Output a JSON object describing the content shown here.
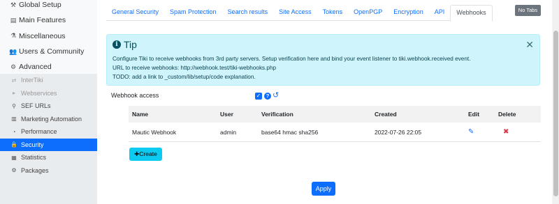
{
  "sidebar": {
    "top_items": [
      {
        "icon": "wrench-icon",
        "glyph": "⚒",
        "label": "Global Setup"
      },
      {
        "icon": "features-icon",
        "glyph": "▤",
        "label": "Main Features"
      },
      {
        "icon": "misc-icon",
        "glyph": "⚗",
        "label": "Miscellaneous"
      },
      {
        "icon": "users-icon",
        "glyph": "👥",
        "label": "Users & Community"
      },
      {
        "icon": "cogs-icon",
        "glyph": "⚙",
        "label": "Advanced"
      }
    ],
    "sub_items": [
      {
        "icon": "exchange-icon",
        "glyph": "⇄",
        "label": "InterTiki"
      },
      {
        "icon": "pointer-icon",
        "glyph": "▸",
        "label": "Webservices"
      },
      {
        "icon": "search-icon",
        "glyph": "⚲",
        "label": "SEF URLs"
      },
      {
        "icon": "chart-icon",
        "glyph": "▥",
        "label": "Marketing Automation"
      },
      {
        "icon": "gauge-icon",
        "glyph": "◔",
        "label": "Performance"
      },
      {
        "icon": "lock-icon",
        "glyph": "🔒",
        "label": "Security"
      },
      {
        "icon": "stats-icon",
        "glyph": "▦",
        "label": "Statistics"
      },
      {
        "icon": "packages-icon",
        "glyph": "⚙",
        "label": "Packages"
      }
    ]
  },
  "tabs": [
    "General Security",
    "Spam Protection",
    "Search results",
    "Site Access",
    "Tokens",
    "OpenPGP",
    "Encryption",
    "API",
    "Webhooks"
  ],
  "no_tabs_label": "No Tabs",
  "tip": {
    "title": "Tip",
    "lines": [
      "Configure Tiki to receive webhooks from 3rd party servers. Setup verification here and bind your event listener to tiki.webhook.received event.",
      "URL to receive webhooks: http://webhook.test/tiki-webhooks.php",
      "TODO: add a link to _custom/lib/setup/code explanation."
    ]
  },
  "webhook_access_label": "Webhook access",
  "table": {
    "headers": [
      "Name",
      "User",
      "Verification",
      "Created",
      "Edit",
      "Delete"
    ],
    "rows": [
      {
        "name": "Mautic Webhook",
        "user": "admin",
        "verification": "base64 hmac sha256",
        "created": "2022-07-26 22:05"
      }
    ]
  },
  "create_label": "Create",
  "apply_label": "Apply",
  "colors": {
    "accent": "#0d6efd",
    "tip_bg": "#cff4fc",
    "create_bg": "#0dcaf0"
  }
}
